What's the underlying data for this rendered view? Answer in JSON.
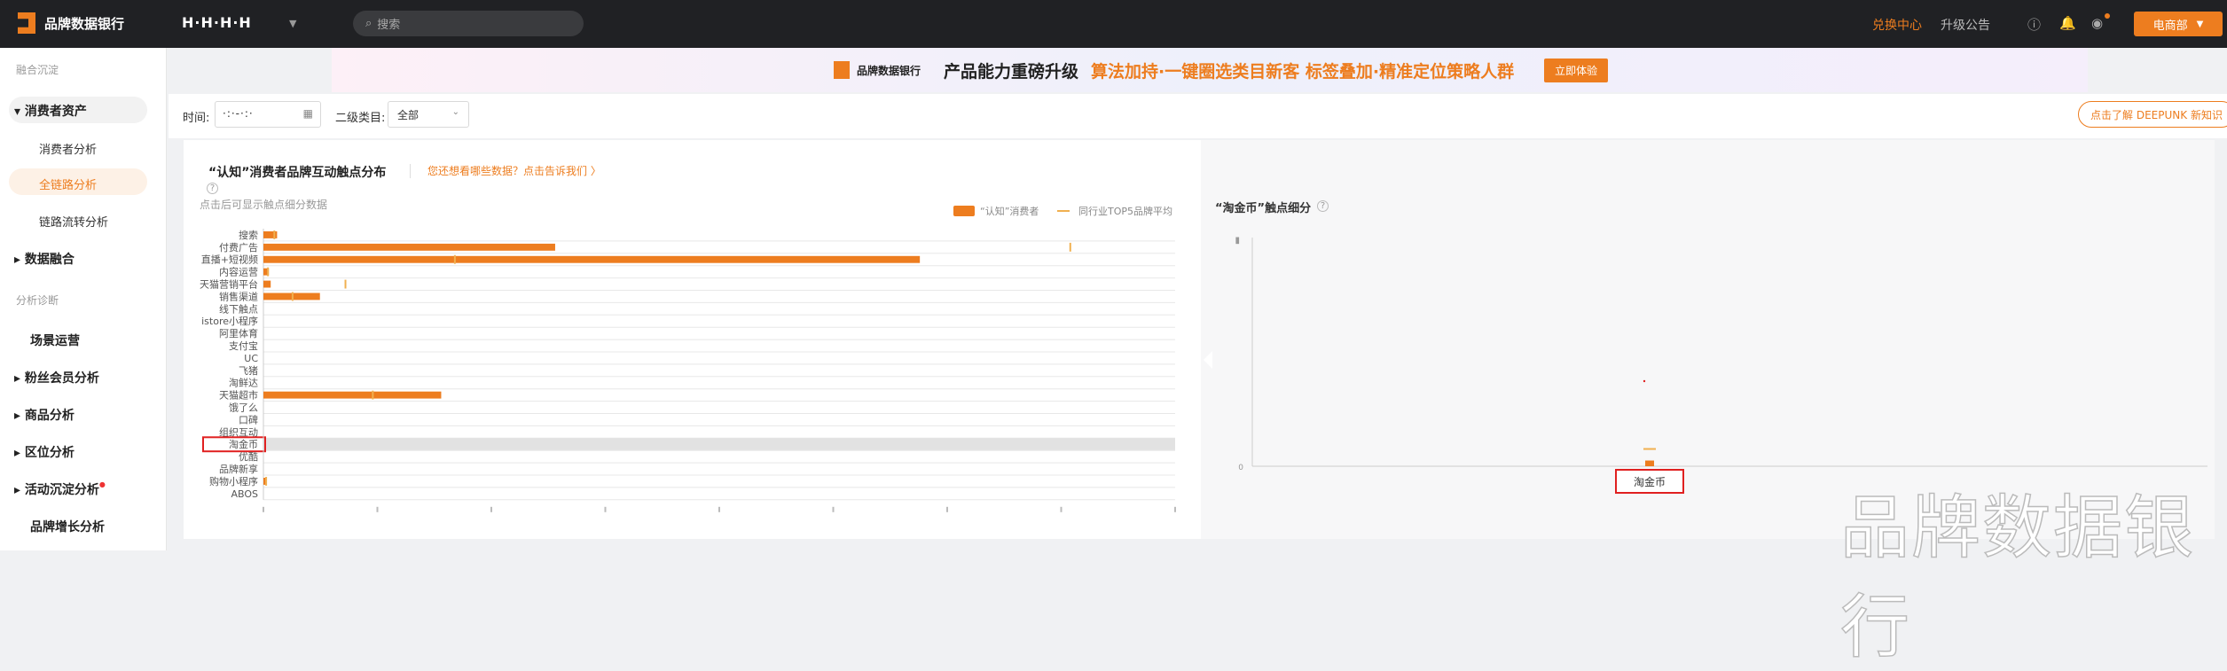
{
  "header": {
    "brand": "品牌数据银行",
    "shop_name": "H·H·H·H",
    "search_placeholder": "搜索",
    "links": {
      "exchange": "兑换中心",
      "announce": "升级公告"
    },
    "dept_button": "电商部",
    "colors": {
      "accent": "#ed7d1f",
      "dark": "#202124"
    }
  },
  "sidebar": {
    "section1": "融合沉淀",
    "consumer_assets": "消费者资产",
    "consumer_analysis": "消费者分析",
    "full_link": "全链路分析",
    "link_flow": "链路流转分析",
    "data_fusion": "数据融合",
    "section2": "分析诊断",
    "scene_ops": "场景运营",
    "fan_member": "粉丝会员分析",
    "product": "商品分析",
    "region": "区位分析",
    "activity": "活动沉淀分析",
    "brand_growth": "品牌增长分析"
  },
  "banner": {
    "brand": "品牌数据银行",
    "text1": "产品能力重磅升级",
    "text2": "算法加持·一键圈选类目新客  标签叠加·精准定位策略人群",
    "button": "立即体验"
  },
  "filter": {
    "time_label": "时间:",
    "date_value": "·:·-·:·",
    "category_label": "二级类目:",
    "category_value": "全部",
    "deepunk_button": "点击了解 DEEPUNK 新知识"
  },
  "panel": {
    "title": "“认知”消费者品牌互动触点分布",
    "feedback_link": "您还想看哪些数据？点击告诉我们 〉",
    "hint": "点击后可显示触点细分数据",
    "legend": [
      "“认知”消费者",
      "同行业TOP5品牌平均"
    ],
    "right_title": "“淘金币”触点细分"
  },
  "chart_data": [
    {
      "type": "bar",
      "orientation": "horizontal",
      "categories": [
        "搜索",
        "付费广告",
        "直播+短视频",
        "内容运营",
        "天猫营销平台",
        "销售渠道",
        "线下触点",
        "istore小程序",
        "阿里体育",
        "支付宝",
        "UC",
        "飞猪",
        "淘鲜达",
        "天猫超市",
        "饿了么",
        "口碑",
        "组织互动",
        "淘金币",
        "优酷",
        "品牌新享",
        "购物小程序",
        "ABOS"
      ],
      "series": [
        {
          "name": "“认知”消费者",
          "values": [
            1.5,
            32,
            72,
            0.6,
            0.8,
            6.2,
            0,
            0,
            0,
            0,
            0,
            0,
            0,
            19.5,
            0,
            0,
            0,
            0,
            0,
            0,
            0.3,
            0
          ],
          "color": "#ed7d1f"
        },
        {
          "name": "同行业TOP5品牌平均",
          "values": [
            1.2,
            88.5,
            21,
            0.5,
            9,
            3.2,
            0,
            0,
            0,
            0,
            0,
            0,
            0,
            12,
            0,
            0,
            0,
            0,
            0,
            0,
            0.3,
            0
          ],
          "color": "#f0b050"
        }
      ],
      "selected_category": "淘金币",
      "xlim": [
        0,
        100
      ],
      "grid": true,
      "legend_position": "top-right"
    },
    {
      "type": "bar",
      "categories": [
        "淘金币"
      ],
      "series": [
        {
          "name": "“认知”消费者",
          "values": [
            0.5
          ],
          "color": "#ed7d1f"
        },
        {
          "name": "同行业TOP5品牌平均",
          "values": [
            1.2
          ],
          "color": "#f0b050"
        }
      ],
      "ylim": [
        0,
        20
      ],
      "yticks": [
        "0"
      ]
    }
  ],
  "watermark": "品牌数据银行"
}
